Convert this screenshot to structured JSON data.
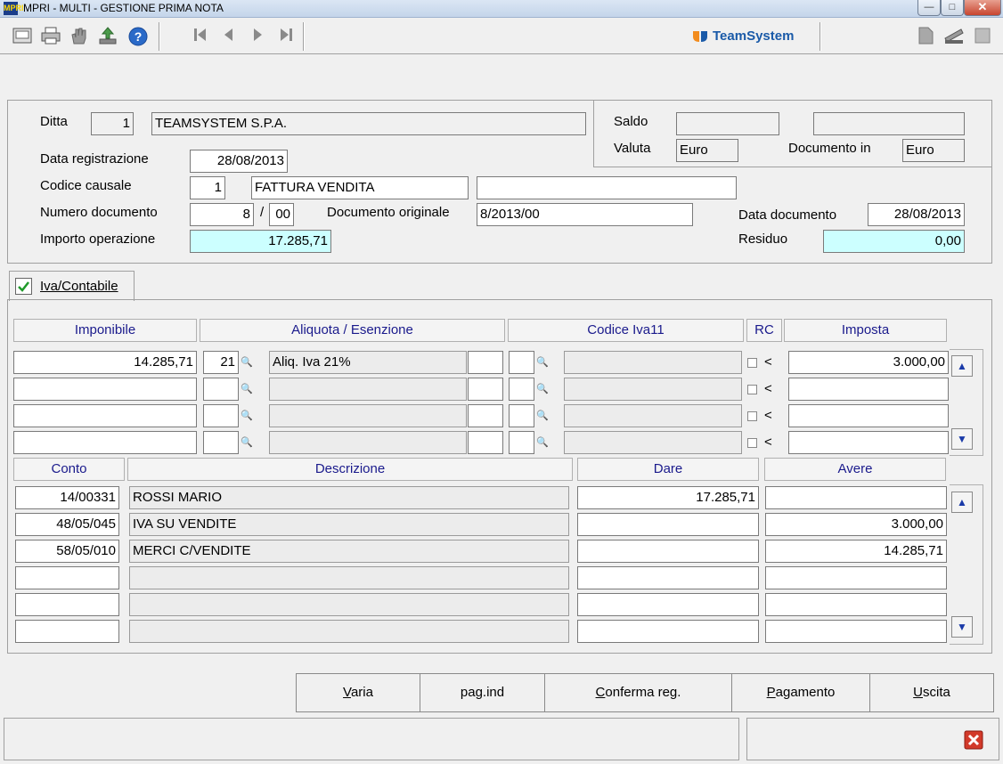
{
  "window": {
    "title": "MPRI  - MULTI -  GESTIONE PRIMA NOTA",
    "icon_text": "MPRI",
    "brand": "TeamSystem"
  },
  "colors": {
    "accent_cyan": "#ccffff",
    "header_text": "#1a1a8c",
    "brand_blue": "#1a5aa8",
    "close_red": "#c7452f"
  },
  "toolbar": {
    "icons": [
      "print-preview-icon",
      "printer-icon",
      "hand-icon",
      "download-icon",
      "help-icon",
      "first-record-icon",
      "prev-record-icon",
      "next-record-icon",
      "last-record-icon",
      "document-icon",
      "scanner-icon",
      "stack-icon"
    ]
  },
  "header": {
    "ditta_label": "Ditta",
    "ditta_code": "1",
    "ditta_name": "TEAMSYSTEM S.P.A.",
    "saldo_label": "Saldo",
    "saldo_value": "",
    "saldo_value2": "",
    "valuta_label": "Valuta",
    "valuta_value": "Euro",
    "documento_in_label": "Documento in",
    "documento_in_value": "Euro",
    "data_registrazione_label": "Data registrazione",
    "data_registrazione": "28/08/2013",
    "codice_causale_label": "Codice causale",
    "codice_causale": "1",
    "causale_descr": "FATTURA VENDITA",
    "causale_extra": "",
    "numero_documento_label": "Numero documento",
    "numero_documento": "8",
    "slash": "/",
    "numero_suffix": "00",
    "documento_originale_label": "Documento originale",
    "documento_originale": "8/2013/00",
    "data_documento_label": "Data documento",
    "data_documento": "28/08/2013",
    "importo_label": "Importo operazione",
    "importo": "17.285,71",
    "residuo_label": "Residuo",
    "residuo": "0,00"
  },
  "tab": {
    "label": "Iva/Contabile",
    "checked": true
  },
  "iva_table": {
    "headers": [
      "Imponibile",
      "Aliquota / Esenzione",
      "Codice Iva11",
      "RC",
      "Imposta"
    ],
    "rows": [
      {
        "imponibile": "14.285,71",
        "aliquota": "21",
        "descr": "Aliq. Iva 21%",
        "extra": "",
        "codice": "",
        "codice_descr": "",
        "lt": "<",
        "imposta": "3.000,00"
      },
      {
        "imponibile": "",
        "aliquota": "",
        "descr": "",
        "extra": "",
        "codice": "",
        "codice_descr": "",
        "lt": "<",
        "imposta": ""
      },
      {
        "imponibile": "",
        "aliquota": "",
        "descr": "",
        "extra": "",
        "codice": "",
        "codice_descr": "",
        "lt": "<",
        "imposta": ""
      },
      {
        "imponibile": "",
        "aliquota": "",
        "descr": "",
        "extra": "",
        "codice": "",
        "codice_descr": "",
        "lt": "<",
        "imposta": ""
      }
    ]
  },
  "conto_table": {
    "headers": [
      "Conto",
      "Descrizione",
      "Dare",
      "Avere"
    ],
    "rows": [
      {
        "conto": "14/00331",
        "descr": "ROSSI MARIO",
        "dare": "17.285,71",
        "avere": ""
      },
      {
        "conto": "48/05/045",
        "descr": "IVA SU VENDITE",
        "dare": "",
        "avere": "3.000,00"
      },
      {
        "conto": "58/05/010",
        "descr": "MERCI C/VENDITE",
        "dare": "",
        "avere": "14.285,71"
      },
      {
        "conto": "",
        "descr": "",
        "dare": "",
        "avere": ""
      },
      {
        "conto": "",
        "descr": "",
        "dare": "",
        "avere": ""
      },
      {
        "conto": "",
        "descr": "",
        "dare": "",
        "avere": ""
      }
    ]
  },
  "buttons": [
    {
      "key": "V",
      "rest": "aria"
    },
    {
      "key": "",
      "rest": "pag.ind"
    },
    {
      "key": "C",
      "rest": "onferma reg."
    },
    {
      "key": "P",
      "rest": "agamento"
    },
    {
      "key": "U",
      "rest": "scita"
    }
  ]
}
